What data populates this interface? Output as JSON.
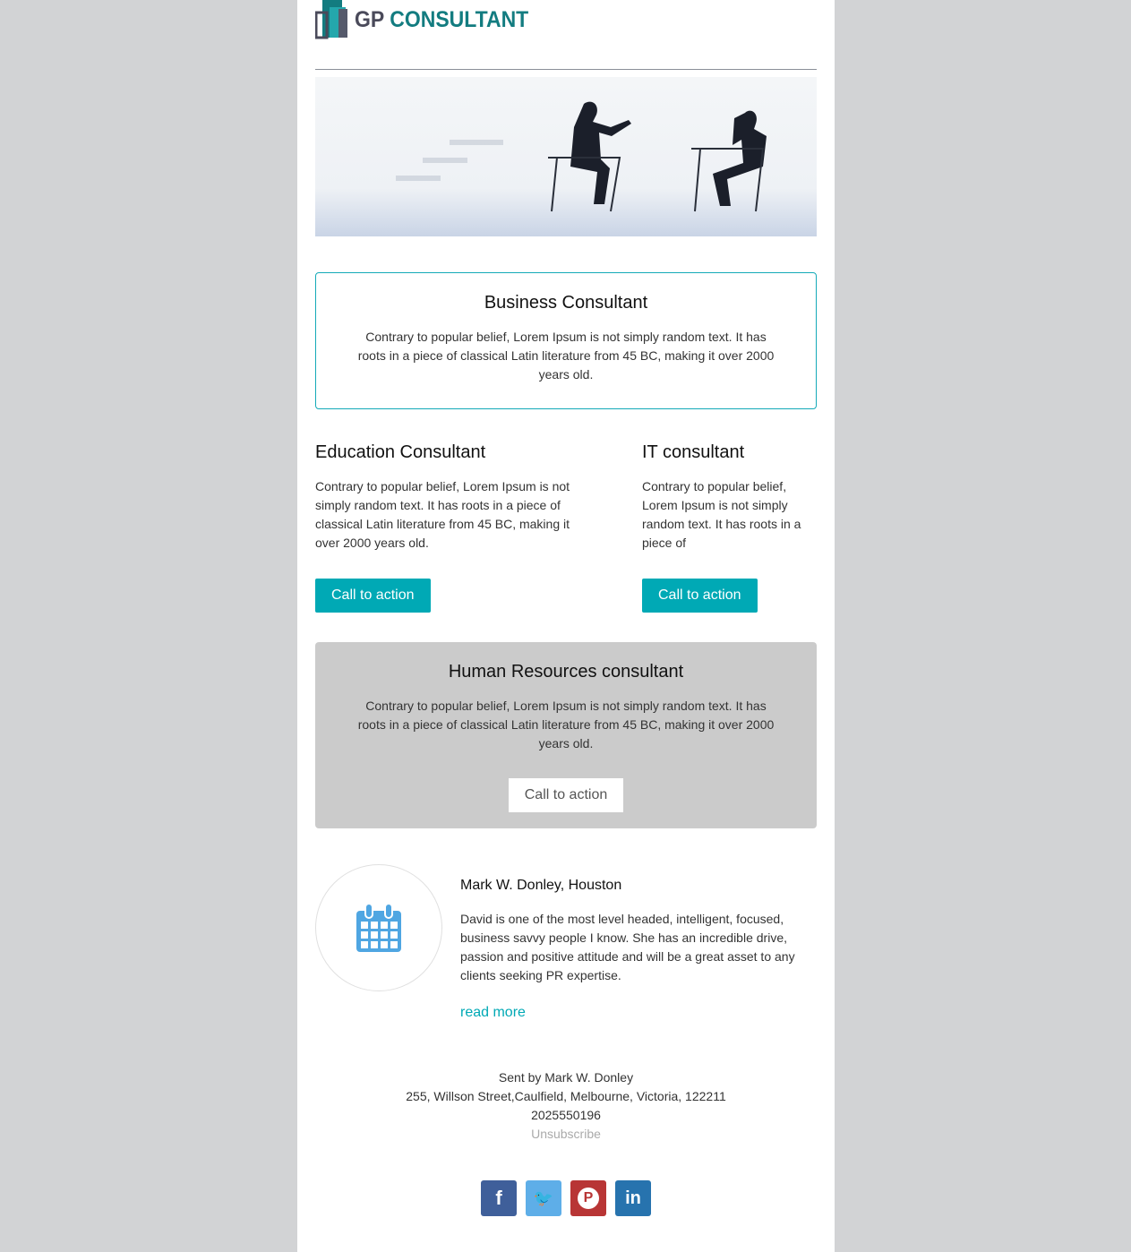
{
  "header": {
    "logo_text": "GP CONSULTANT",
    "logo_gp": "GP",
    "logo_consultant": "CONSULTANT"
  },
  "featured": {
    "title": "Business Consultant",
    "body": "Contrary to popular belief, Lorem Ipsum is not simply random text. It has roots in a piece of classical Latin literature from 45 BC, making it over 2000 years old."
  },
  "columns": [
    {
      "title": "Education Consultant",
      "body": "Contrary to popular belief, Lorem Ipsum is not simply random text. It has roots in a piece of classical Latin literature from 45 BC, making it over 2000 years old.",
      "cta": "Call to action"
    },
    {
      "title": "IT consultant",
      "body": "Contrary to popular belief, Lorem Ipsum is not simply random text. It has roots in a piece of",
      "cta": "Call to action"
    }
  ],
  "hr_box": {
    "title": "Human Resources consultant",
    "body": "Contrary to popular belief, Lorem Ipsum is not simply random text. It has roots in a piece of classical Latin literature from 45 BC, making it over 2000 years old.",
    "cta": "Call to action"
  },
  "testimonial": {
    "icon": "calendar-icon",
    "name": "Mark W. Donley, Houston",
    "body": "David is one of the most level headed, intelligent, focused, business savvy people I know. She has an incredible drive, passion and positive attitude and will be a great asset to any clients seeking PR expertise.",
    "link": "read more"
  },
  "footer": {
    "sent_by": "Sent by Mark W. Donley",
    "address": "255, Willson Street,Caulfield, Melbourne, Victoria, 122211",
    "phone": "2025550196",
    "unsubscribe": "Unsubscribe"
  },
  "social": [
    {
      "name": "facebook",
      "glyph": "f",
      "color": "#3f5f9a"
    },
    {
      "name": "twitter",
      "glyph": "🐦",
      "color": "#5eaee8"
    },
    {
      "name": "pinterest",
      "glyph": "P",
      "color": "#b83535"
    },
    {
      "name": "linkedin",
      "glyph": "in",
      "color": "#2773ae"
    }
  ],
  "colors": {
    "accent": "#00a9b5",
    "logo_dark": "#4a4a5a",
    "logo_teal": "#137c80"
  }
}
